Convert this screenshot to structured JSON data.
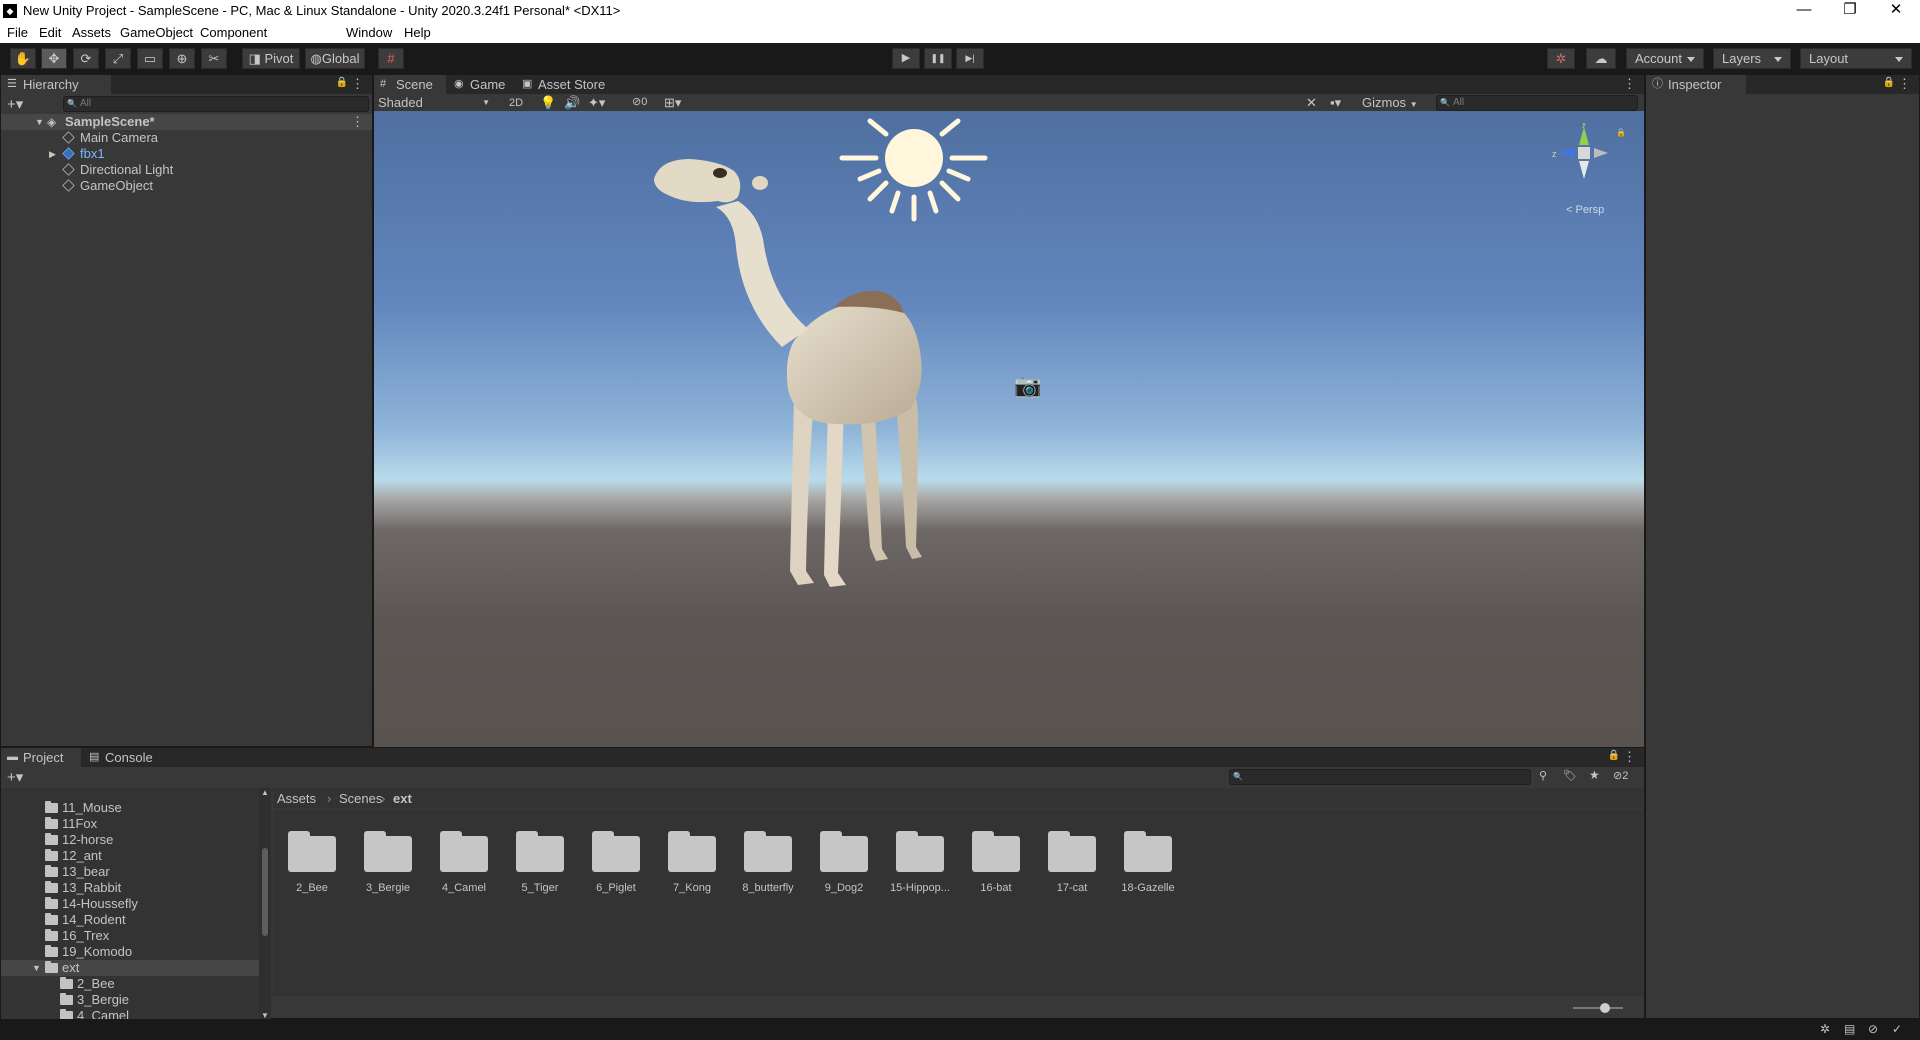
{
  "window": {
    "title": "New Unity Project - SampleScene - PC, Mac & Linux Standalone - Unity 2020.3.24f1 Personal* <DX11>",
    "logo": "unity-logo-icon",
    "controls": {
      "minimize": "—",
      "restore": "❐",
      "close": "✕"
    }
  },
  "menu": [
    "File",
    "Edit",
    "Assets",
    "GameObject",
    "Component",
    "Window",
    "Help"
  ],
  "toolbar": {
    "tools": [
      "hand-tool-icon",
      "move-tool-icon",
      "rotate-tool-icon",
      "scale-tool-icon",
      "rect-tool-icon",
      "transform-tool-icon",
      "custom-tool-icon"
    ],
    "pivot_label": "Pivot",
    "global_label": "Global",
    "play": "▶",
    "pause": "❚❚",
    "step": "▶|",
    "account_label": "Account",
    "layers_label": "Layers",
    "layout_label": "Layout"
  },
  "hierarchy": {
    "tab_label": "Hierarchy",
    "search_placeholder": "All",
    "scene_name": "SampleScene*",
    "items": [
      {
        "label": "Main Camera",
        "prefab": false,
        "expandable": false
      },
      {
        "label": "fbx1",
        "prefab": true,
        "expandable": true
      },
      {
        "label": "Directional Light",
        "prefab": false,
        "expandable": false
      },
      {
        "label": "GameObject",
        "prefab": false,
        "expandable": false
      }
    ]
  },
  "scene_view": {
    "tabs": [
      "Scene",
      "Game",
      "Asset Store"
    ],
    "shading_mode": "Shaded",
    "mode_2d": "2D",
    "hidden_count": "0",
    "gizmos_label": "Gizmos",
    "search_placeholder": "All",
    "gizmo_z_label": "z",
    "gizmo_y_label": "y",
    "persp_label": "< Persp",
    "colors": {
      "sky_top": "#4f6fa0",
      "horizon": "#b9dbea",
      "ground": "#59534f",
      "sun": "#fff6dc"
    }
  },
  "inspector": {
    "tab_label": "Inspector"
  },
  "project": {
    "tabs": [
      "Project",
      "Console"
    ],
    "hidden_count": "2",
    "tree": [
      {
        "label": "11_Mouse",
        "indent": 1
      },
      {
        "label": "11Fox",
        "indent": 1
      },
      {
        "label": "12-horse",
        "indent": 1
      },
      {
        "label": "12_ant",
        "indent": 1
      },
      {
        "label": "13_bear",
        "indent": 1
      },
      {
        "label": "13_Rabbit",
        "indent": 1
      },
      {
        "label": "14-Houssefly",
        "indent": 1
      },
      {
        "label": "14_Rodent",
        "indent": 1
      },
      {
        "label": "16_Trex",
        "indent": 1
      },
      {
        "label": "19_Komodo",
        "indent": 1
      },
      {
        "label": "ext",
        "indent": 0,
        "selected": true,
        "open": true
      },
      {
        "label": "2_Bee",
        "indent": 2
      },
      {
        "label": "3_Bergie",
        "indent": 2
      },
      {
        "label": "4_Camel",
        "indent": 2
      }
    ],
    "breadcrumb": [
      "Assets",
      "Scenes",
      "ext"
    ],
    "folders": [
      "2_Bee",
      "3_Bergie",
      "4_Camel",
      "5_Tiger",
      "6_Piglet",
      "7_Kong",
      "8_butterfly",
      "9_Dog2",
      "15-Hippop...",
      "16-bat",
      "17-cat",
      "18-Gazelle"
    ]
  }
}
